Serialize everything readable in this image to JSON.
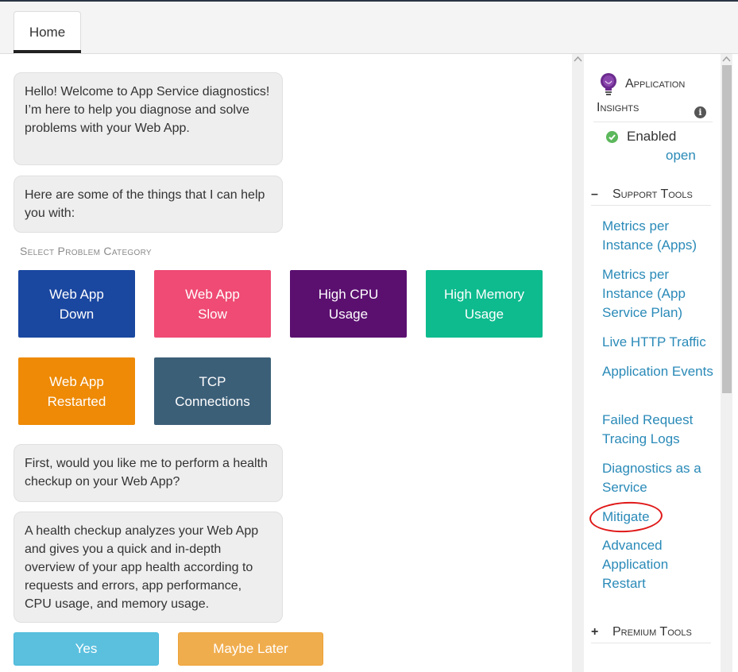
{
  "tabs": {
    "home": "Home"
  },
  "chat": {
    "welcome": "Hello! Welcome to App Service diagnostics! I’m here to help you diagnose and solve problems with your Web App.",
    "things": "Here are some of the things that I can help you with:",
    "category_label": "Select Problem Category",
    "categories": [
      {
        "label": "Web App Down",
        "color": "#1a47a0"
      },
      {
        "label": "Web App Slow",
        "color": "#ef4b74"
      },
      {
        "label": "High CPU Usage",
        "color": "#5b1070"
      },
      {
        "label": "High Memory Usage",
        "color": "#0dbb8e"
      },
      {
        "label": "Web App Restarted",
        "color": "#ee8a06"
      },
      {
        "label": "TCP Connections",
        "color": "#3c5f78"
      }
    ],
    "health_question": "First, would you like me to perform a health checkup on your Web App?",
    "health_description": "A health checkup analyzes your Web App and gives you a quick and in-depth overview of your app health according to requests and errors, app performance, CPU usage, and memory usage.",
    "yes_label": "Yes",
    "later_label": "Maybe Later"
  },
  "sidebar": {
    "app_insights": {
      "title_line1": "Application",
      "title_line2": "Insights",
      "info_icon": "i",
      "status": "Enabled",
      "open_link": "open"
    },
    "support_tools": {
      "sign": "–",
      "title": "Support Tools",
      "links": [
        "Metrics per Instance (Apps)",
        "Metrics per Instance (App Service Plan)",
        "Live HTTP Traffic",
        "Application Events",
        "Failed Request Tracing Logs",
        "Diagnostics as a Service",
        "Mitigate",
        "Advanced Application Restart"
      ]
    },
    "premium_tools": {
      "sign": "+",
      "title": "Premium Tools"
    }
  }
}
